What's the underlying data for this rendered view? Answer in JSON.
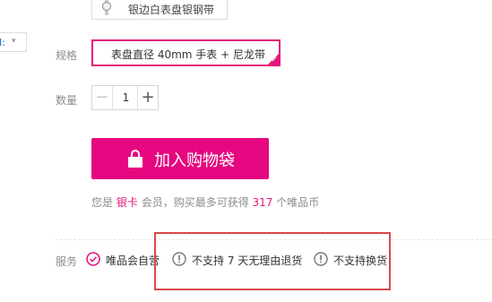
{
  "top_option": {
    "label": "银边白表盘银钢带"
  },
  "left_dropdown": {
    "text": "I:"
  },
  "spec": {
    "label": "规格",
    "selected": "表盘直径 40mm 手表 + 尼龙带"
  },
  "quantity": {
    "label": "数量",
    "minus": "−",
    "value": "1",
    "plus": "+"
  },
  "add_to_bag": {
    "label": "加入购物袋"
  },
  "member": {
    "prefix": "您是",
    "level": "银卡",
    "middle": "会员，购买最多可获得",
    "points": "317",
    "suffix": "个唯品币"
  },
  "services": {
    "label": "服务",
    "items": [
      {
        "text": "唯品会自营",
        "icon": "check-circle-icon"
      },
      {
        "text": "不支持 7 天无理由退货",
        "icon": "exclamation-circle-icon"
      },
      {
        "text": "不支持换货",
        "icon": "exclamation-circle-icon"
      }
    ]
  },
  "colors": {
    "accent": "#e5077f",
    "highlight": "#d84a4a"
  }
}
